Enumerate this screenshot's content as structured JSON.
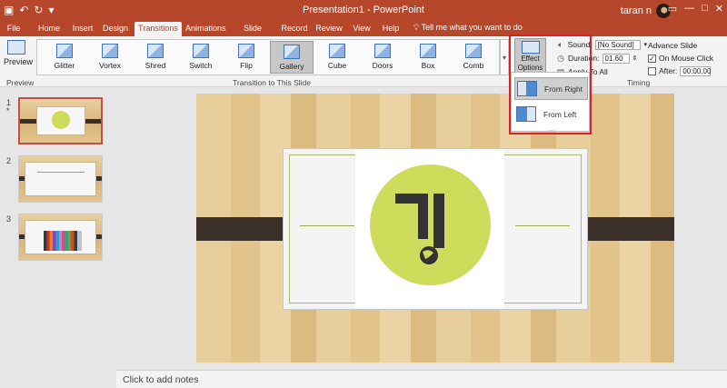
{
  "window": {
    "title": "Presentation1 - PowerPoint",
    "user": "taran n",
    "quick_access": [
      "save-icon",
      "undo-icon",
      "redo-icon",
      "customize-icon"
    ],
    "controls": [
      "ribbon-display-icon",
      "minimize-icon",
      "maximize-icon",
      "close-icon"
    ]
  },
  "tabs": [
    "File",
    "Home",
    "Insert",
    "Design",
    "Transitions",
    "Animations",
    "Slide Show",
    "Record",
    "Review",
    "View",
    "Help"
  ],
  "active_tab": "Transitions",
  "tell_me": "Tell me what you want to do",
  "ribbon": {
    "preview_label": "Preview",
    "preview_group": "Preview",
    "transitions": [
      "Glitter",
      "Vortex",
      "Shred",
      "Switch",
      "Flip",
      "Gallery",
      "Cube",
      "Doors",
      "Box",
      "Comb"
    ],
    "selected_transition": "Gallery",
    "transition_group": "Transition to This Slide",
    "effect_options_label_1": "Effect",
    "effect_options_label_2": "Options",
    "sound_label": "Sound:",
    "sound_value": "[No Sound]",
    "duration_label": "Duration:",
    "duration_value": "01.60",
    "apply_all": "Apply To All",
    "advance_slide": "Advance Slide",
    "on_mouse_click": "On Mouse Click",
    "on_mouse_click_checked": true,
    "after_label": "After:",
    "after_checked": false,
    "after_value": "00:00.00",
    "timing_group": "Timing"
  },
  "effect_options_menu": {
    "items": [
      "From Right",
      "From Left"
    ],
    "selected": "From Right"
  },
  "slides": {
    "numbers": [
      "1",
      "2",
      "3"
    ],
    "star": "*",
    "selected": 1
  },
  "notes_placeholder": "Click to add notes",
  "colors": {
    "accent": "#b7472a",
    "logo_green": "#cddc5a",
    "band_dark": "#3b2f29",
    "highlight_box": "#e02020"
  }
}
